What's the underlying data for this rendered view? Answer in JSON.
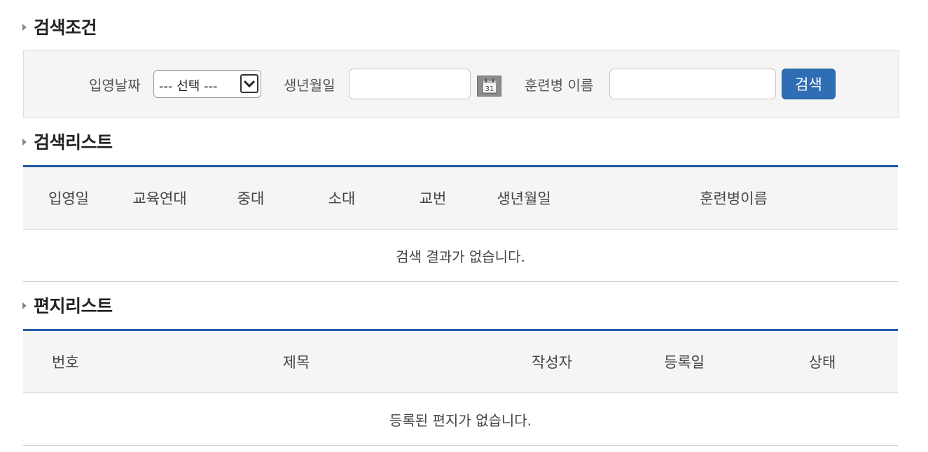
{
  "sections": {
    "search_title": "검색조건",
    "results_title": "검색리스트",
    "letters_title": "편지리스트"
  },
  "search_form": {
    "entry_date_label": "입영날짜",
    "entry_date_selected": "--- 선택 ---",
    "birthdate_label": "생년월일",
    "birthdate_value": "",
    "calendar_icon_text": "31",
    "trainee_name_label": "훈련병 이름",
    "trainee_name_value": "",
    "search_button_label": "검색"
  },
  "results_table": {
    "columns": [
      "입영일",
      "교육연대",
      "중대",
      "소대",
      "교번",
      "생년월일",
      "훈련병이름"
    ],
    "empty_message": "검색 결과가 없습니다."
  },
  "letters_table": {
    "columns": [
      "번호",
      "제목",
      "작성자",
      "등록일",
      "상태"
    ],
    "empty_message": "등록된 편지가 없습니다."
  },
  "colors": {
    "accent_border": "#1f5aa6",
    "search_button": "#2f6eb5",
    "panel_background": "#f5f5f5"
  },
  "icons": {
    "section_marker": "triangle-right-icon",
    "select_arrow": "chevron-down-icon",
    "date_picker": "calendar-icon"
  }
}
